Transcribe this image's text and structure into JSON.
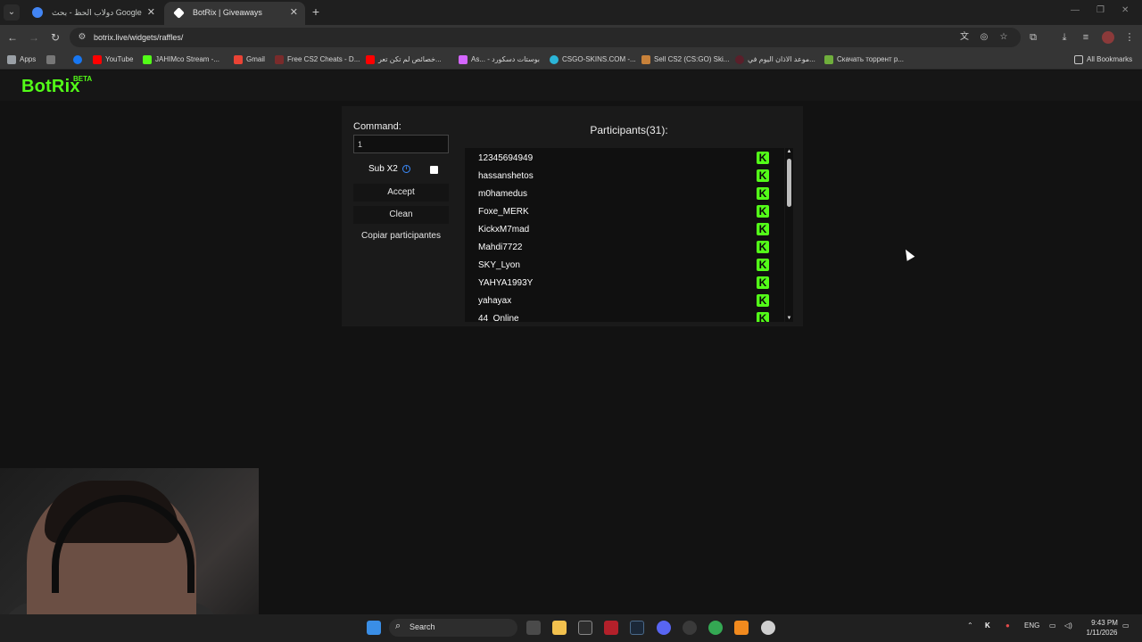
{
  "browser": {
    "tabs": [
      {
        "title": "دولاب الحظ - بحث Google",
        "active": false
      },
      {
        "title": "BotRix | Giveaways",
        "active": true
      }
    ],
    "url": "botrix.live/widgets/raffles/",
    "bookmarks": [
      "Apps",
      "YouTube",
      "JAHIMco Stream -...",
      "Gmail",
      "Free CS2 Cheats - D...",
      "خصائص لم تكن تعر...",
      "As... - بوستات دسكورد",
      "CSGO-SKINS.COM -...",
      "Sell CS2 (CS:GO) Ski...",
      "موعد الاذان اليوم في...",
      "Скачать торрент р..."
    ],
    "all_bookmarks": "All Bookmarks"
  },
  "site": {
    "logo": "BotRix",
    "logo_badge": "BETA"
  },
  "raffle": {
    "command_label": "Command:",
    "command_value": "1",
    "sub_label": "Sub X2",
    "sub_checked": false,
    "accept_label": "Accept",
    "clean_label": "Clean",
    "copy_label": "Copiar participantes",
    "participants_title": "Participants(31):",
    "participants": [
      "12345694949",
      "hassanshetos",
      "m0hamedus",
      "Foxe_MERK",
      "KickxM7mad",
      "Mahdi7722",
      "SKY_Lyon",
      "YAHYA1993Y",
      "yahayax",
      "44_Online"
    ],
    "platform_icon": "kick-icon",
    "accent_color": "#53fc18"
  },
  "taskbar": {
    "search_label": "Search",
    "lang": "ENG",
    "time": "9:43 PM",
    "date": "1/11/2026"
  }
}
